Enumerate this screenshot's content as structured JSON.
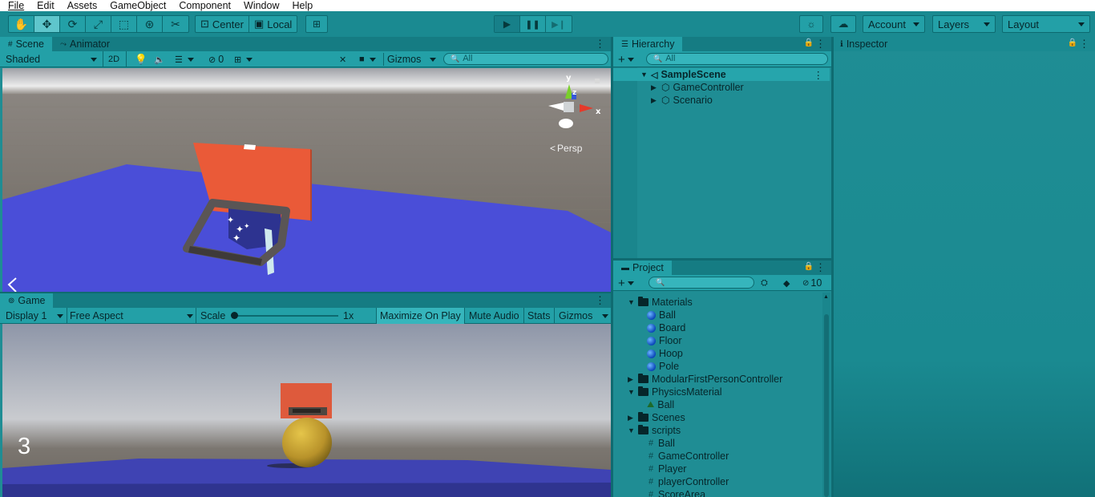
{
  "menu": [
    "File",
    "Edit",
    "Assets",
    "GameObject",
    "Component",
    "Window",
    "Help"
  ],
  "toolbar": {
    "tool_icons": [
      "hand-icon",
      "move-icon",
      "rotate-icon",
      "scale-icon",
      "rect-icon",
      "transform-icon",
      "custom-tool-icon"
    ],
    "pivot_label": "Center",
    "space_label": "Local",
    "account_label": "Account",
    "layers_label": "Layers",
    "layout_label": "Layout"
  },
  "scene_panel": {
    "tabs": [
      "Scene",
      "Animator"
    ],
    "shading_mode": "Shaded",
    "mode_2d": "2D",
    "hidden_count": "0",
    "gizmos_label": "Gizmos",
    "search_placeholder": "All",
    "gizmo_y": "y",
    "gizmo_z": "z",
    "gizmo_x": "x",
    "projection": "Persp"
  },
  "game_panel": {
    "tab": "Game",
    "display": "Display 1",
    "aspect": "Free Aspect",
    "scale_label": "Scale",
    "scale_value": "1x",
    "maximize_label": "Maximize On Play",
    "mute_label": "Mute Audio",
    "stats_label": "Stats",
    "gizmos_label": "Gizmos",
    "score_text": "3"
  },
  "hierarchy": {
    "tab": "Hierarchy",
    "search_placeholder": "All",
    "scene_name": "SampleScene",
    "objects": [
      "GameController",
      "Scenario"
    ]
  },
  "project": {
    "tab": "Project",
    "hidden_count": "10",
    "tree": [
      {
        "label": "Materials",
        "kind": "folder",
        "depth": 1,
        "expanded": true
      },
      {
        "label": "Ball",
        "kind": "material",
        "depth": 2
      },
      {
        "label": "Board",
        "kind": "material",
        "depth": 2
      },
      {
        "label": "Floor",
        "kind": "material",
        "depth": 2
      },
      {
        "label": "Hoop",
        "kind": "material",
        "depth": 2
      },
      {
        "label": "Pole",
        "kind": "material",
        "depth": 2
      },
      {
        "label": "ModularFirstPersonController",
        "kind": "folder",
        "depth": 1,
        "expanded": false
      },
      {
        "label": "PhysicsMaterial",
        "kind": "folder",
        "depth": 1,
        "expanded": true
      },
      {
        "label": "Ball",
        "kind": "physics",
        "depth": 2
      },
      {
        "label": "Scenes",
        "kind": "folder",
        "depth": 1,
        "expanded": false
      },
      {
        "label": "scripts",
        "kind": "folder",
        "depth": 1,
        "expanded": true
      },
      {
        "label": "Ball",
        "kind": "script",
        "depth": 2
      },
      {
        "label": "GameController",
        "kind": "script",
        "depth": 2
      },
      {
        "label": "Player",
        "kind": "script",
        "depth": 2
      },
      {
        "label": "playerController",
        "kind": "script",
        "depth": 2
      },
      {
        "label": "ScoreArea",
        "kind": "script",
        "depth": 2
      }
    ]
  },
  "inspector": {
    "tab": "Inspector"
  },
  "colors": {
    "ui_teal": "#1f8d94",
    "floor_blue": "#4a4ed8",
    "board_red": "#e85a3a",
    "ball_gold": "#c9a534"
  }
}
